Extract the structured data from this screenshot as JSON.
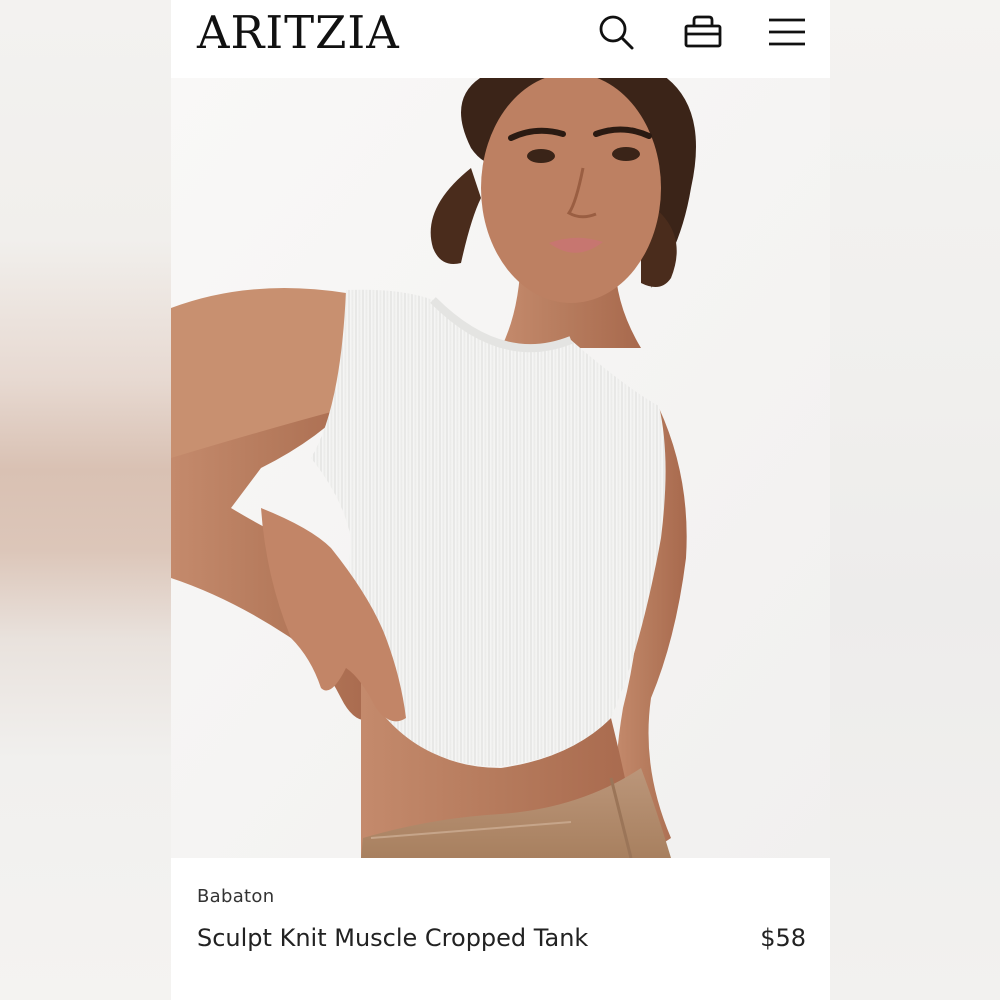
{
  "header": {
    "logo": "ARITZIA",
    "icons": [
      "search-icon",
      "bag-icon",
      "menu-icon"
    ]
  },
  "product": {
    "image_alt": "Model wearing white ribbed cropped tank with tan leather pants",
    "brand": "Babaton",
    "name": "Sculpt Knit Muscle Cropped Tank",
    "price": "$58"
  },
  "colors": {
    "text": "#222222",
    "background": "#ffffff",
    "tank": "#f4f4f2",
    "pants": "#b08a6c",
    "skin": "#b88064"
  }
}
